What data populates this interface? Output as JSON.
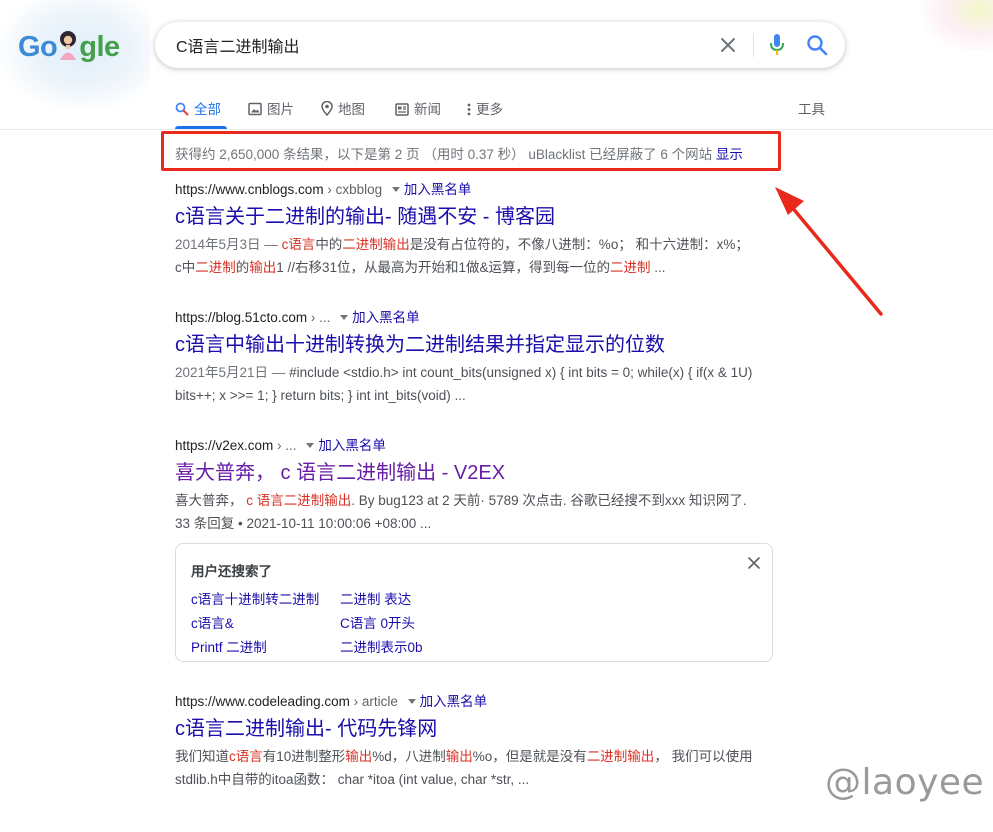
{
  "logo": {
    "left": "Go",
    "right": "gle"
  },
  "search": {
    "query": "C语言二进制输出"
  },
  "tabs": [
    {
      "label": "全部",
      "icon": "search-icon",
      "active": true
    },
    {
      "label": "图片",
      "icon": "image-icon"
    },
    {
      "label": "地图",
      "icon": "map-pin-icon"
    },
    {
      "label": "新闻",
      "icon": "news-icon"
    },
    {
      "label": "更多",
      "icon": "more-vert-icon"
    }
  ],
  "tools_label": "工具",
  "stats": {
    "text": "获得约 2,650,000 条结果，以下是第 2 页 （用时 0.37 秒）  uBlacklist 已经屏蔽了 6 个网站 ",
    "show_link": "显示"
  },
  "blacklist_label": "加入黑名单",
  "results": [
    {
      "url": "https://www.cnblogs.com",
      "crumb": "› cxbblog",
      "title": "c语言关于二进制的输出- 随遇不安 - 博客园",
      "date": "2014年5月3日 — ",
      "s1": "c语言",
      "s2": "中的",
      "s3": "二进制输出",
      "s4": "是没有占位符的，不像八进制：%o； 和十六进制：x%；",
      "s5": "c中",
      "s6": "二进制",
      "s7": "的",
      "s8": "输出",
      "s9": "1 //右移31位，从最高为开始和1做&运算，得到每一位的",
      "s10": "二进制",
      "s11": " ..."
    },
    {
      "url": "https://blog.51cto.com",
      "crumb": "› ...",
      "title": "c语言中输出十进制转换为二进制结果并指定显示的位数",
      "date": "2021年5月21日 — ",
      "line1": "#include <stdio.h> int count_bits(unsigned x) { int bits = 0; while(x) { if(x & 1U)",
      "line2": "bits++; x >>= 1; } return bits; } int int_bits(void) ..."
    },
    {
      "url": "https://v2ex.com",
      "crumb": "› ...",
      "title": "喜大普奔， c 语言二进制输出 - V2EX",
      "s1": "喜大普奔， ",
      "s2": "c 语言二进制输出",
      "s3": ". By bug123 at 2 天前· 5789 次点击. 谷歌已经搜不到xxx 知识网了.",
      "line2": "33 条回复 • 2021-10-11 10:00:06 +08:00 ..."
    },
    {
      "url": "https://www.codeleading.com",
      "crumb": "› article",
      "title": "c语言二进制输出- 代码先锋网",
      "s1": "我们知道",
      "s2": "c语言",
      "s3": "有10进制整形",
      "s4": "输出",
      "s5": "%d，八进制",
      "s6": "输出",
      "s7": "%o，但是就是没有",
      "s8": "二进制输出",
      "s9": "， 我们可以使用",
      "line2": "stdlib.h中自带的itoa函数： char *itoa (int value, char *str, ..."
    }
  ],
  "related": {
    "title": "用户还搜索了",
    "items": [
      "c语言十进制转二进制",
      "二进制 表达",
      "c语言&",
      "C语言 0开头",
      "Printf 二进制",
      "二进制表示0b"
    ]
  },
  "watermark": "@laoyee",
  "colors": {
    "link": "#1a0dab",
    "visited": "#681da8",
    "accent": "#1a73e8",
    "highlight": "#d93025",
    "annotation": "#e8291c"
  }
}
